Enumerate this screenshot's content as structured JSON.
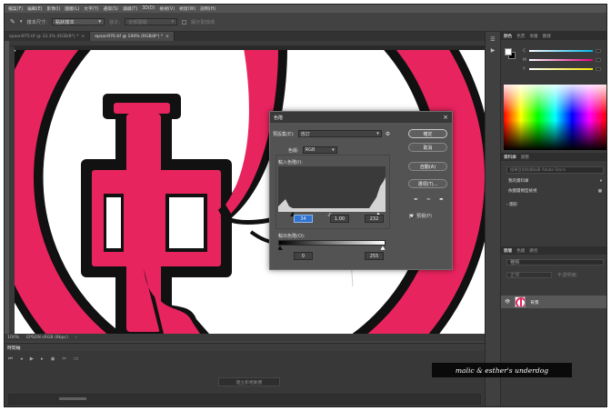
{
  "menubar": {
    "items": [
      "檔案(F)",
      "編輯(E)",
      "影像(I)",
      "圖層(L)",
      "文字(Y)",
      "選取(S)",
      "濾鏡(T)",
      "3D(D)",
      "檢視(V)",
      "視窗(W)",
      "說明(H)"
    ]
  },
  "options": {
    "sample_label": "樣本尺寸:",
    "sample_value": "點狀樣本",
    "sample_layer": "全部圖層",
    "show_ring": "顯示取樣環"
  },
  "tabs": [
    {
      "label": "epson975.tif @ 33.3% (RGB/8*) *"
    },
    {
      "label": "epson976.tif @ 100% (RGB/8*) *"
    }
  ],
  "status": {
    "zoom": "100%",
    "profile": "EPSON sRGB (8bpc)"
  },
  "timeline": {
    "title": "時間軸",
    "create_button": "建立影格動畫"
  },
  "panels": {
    "color_tabs": [
      "顏色",
      "色票",
      "漸層",
      "圖樣"
    ],
    "library_tabs": [
      "資料庫",
      "調整"
    ],
    "library_search": "搜尋目前的資料庫 Adobe Stock",
    "library_select": "我的資料庫",
    "library_sub": "依圖層類型檢視",
    "library_item": "圖形",
    "layers_tabs": [
      "圖層",
      "色版",
      "路徑"
    ],
    "layers_filter": "種類",
    "layers_blend": "正常",
    "layers_opacity_label": "不透明度:",
    "layer_name": "背景"
  },
  "dialog": {
    "title": "色階",
    "preset_label": "預設集(E):",
    "preset_value": "自訂",
    "channel_label": "色版:",
    "channel_value": "RGB",
    "input_label": "輸入色階(I):",
    "input_black": "34",
    "input_gamma": "1.00",
    "input_white": "232",
    "output_label": "輸出色階(O):",
    "output_black": "0",
    "output_white": "255",
    "btn_ok": "確定",
    "btn_cancel": "取消",
    "btn_auto": "自動(A)",
    "btn_options": "選項(T)...",
    "preview_label": "預視(P)"
  },
  "watermark": "malic & esther's underdog",
  "colors": {
    "pink": "#e8245e",
    "accent_blue": "#2f74d0",
    "bg_dark": "#424242"
  }
}
